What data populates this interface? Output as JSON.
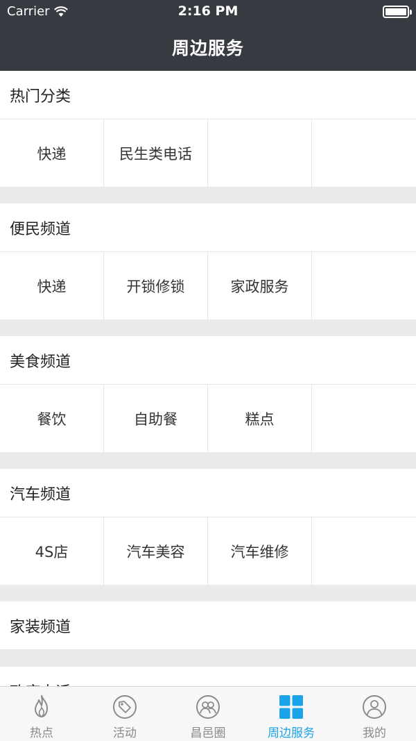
{
  "status_bar": {
    "carrier": "Carrier",
    "time": "2:16 PM"
  },
  "nav": {
    "title": "周边服务"
  },
  "sections": [
    {
      "title": "热门分类",
      "items": [
        "快递",
        "民生类电话",
        "",
        ""
      ]
    },
    {
      "title": "便民频道",
      "items": [
        "快递",
        "开锁修锁",
        "家政服务",
        ""
      ]
    },
    {
      "title": "美食频道",
      "items": [
        "餐饮",
        "自助餐",
        "糕点",
        ""
      ]
    },
    {
      "title": "汽车频道",
      "items": [
        "4S店",
        "汽车美容",
        "汽车维修",
        ""
      ]
    },
    {
      "title": "家装频道"
    },
    {
      "title": "政府电话"
    }
  ],
  "tabs": [
    {
      "label": "热点",
      "icon": "flame-icon"
    },
    {
      "label": "活动",
      "icon": "tag-icon"
    },
    {
      "label": "昌邑圈",
      "icon": "people-icon"
    },
    {
      "label": "周边服务",
      "icon": "grid-icon",
      "active": true
    },
    {
      "label": "我的",
      "icon": "profile-icon"
    }
  ],
  "colors": {
    "navbar": "#373a40",
    "accent": "#1aa3e8",
    "tab_inactive": "#8a8a8a",
    "separator": "#ebebeb"
  }
}
